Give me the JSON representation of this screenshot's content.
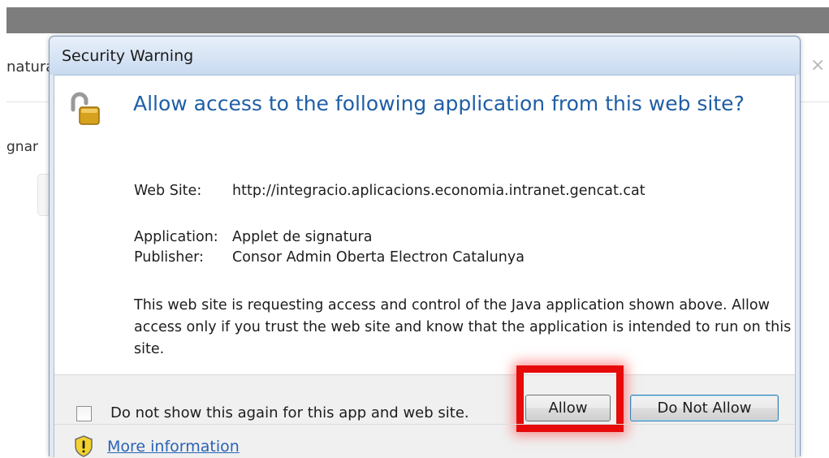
{
  "background": {
    "partial_tab_text": "natura",
    "partial_label_text": "gnar",
    "close_glyph": "×"
  },
  "dialog": {
    "title": "Security Warning",
    "heading": "Allow access to the following application from this web site?",
    "fields": {
      "website_label": "Web Site:",
      "website_value": "http://integracio.aplicacions.economia.intranet.gencat.cat",
      "application_label": "Application:",
      "application_value": "Applet de signatura",
      "publisher_label": "Publisher:",
      "publisher_value": "Consor Admin Oberta Electron Catalunya"
    },
    "description": "This web site is requesting access and control of the Java application shown above. Allow access only if you trust the web site and know that the application is intended to run on this site.",
    "checkbox_label": "Do not show this again for this app and web site.",
    "checkbox_checked": false,
    "allow_label": "Allow",
    "deny_label": "Do Not Allow",
    "more_info_label": "More information",
    "icons": [
      "unlocked-padlock-icon",
      "warning-shield-icon"
    ],
    "highlight_color": "#e60a0a",
    "heading_color": "#1f5ea6"
  }
}
